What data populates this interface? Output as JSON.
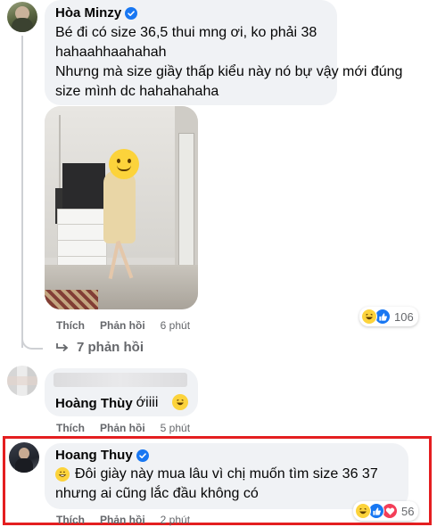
{
  "comment1": {
    "author": "Hòa Minzy",
    "text_lines": [
      "Bé đi có size 36,5 thui mng ơi, ko phải 38",
      "hahaahhaahahah",
      "Nhưng mà size giầy thấp kiểu này nó bự vậy mới đúng",
      "size mình dc hahahahaha"
    ],
    "like_label": "Thích",
    "reply_label": "Phản hồi",
    "time": "6 phút",
    "reaction_count": "106",
    "replies_label": "7 phản hồi"
  },
  "comment2": {
    "author": "Hoàng Thùy",
    "text": "ớiiii",
    "like_label": "Thích",
    "reply_label": "Phản hồi",
    "time": "5 phút"
  },
  "comment3": {
    "author": "Hoang Thuy",
    "text_lines": [
      "Đôi giày này mua lâu vì chị muốn tìm size 36 37",
      "nhưng ai cũng lắc đầu không có"
    ],
    "like_label": "Thích",
    "reply_label": "Phản hồi",
    "time": "2 phút",
    "reaction_count": "56"
  },
  "colors": {
    "bubble": "#f0f2f5",
    "verified": "#1877f2",
    "highlight_border": "#e41e20",
    "secondary_text": "#65676b"
  },
  "icons": [
    "verified-badge-icon",
    "haha-reaction-icon",
    "like-reaction-icon",
    "love-reaction-icon",
    "reply-arrow-icon",
    "grin-emoji-icon"
  ]
}
